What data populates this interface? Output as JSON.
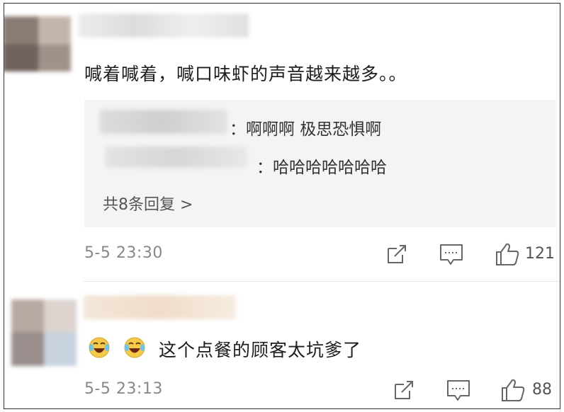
{
  "comments": [
    {
      "text": "喊着喊着，喊口味虾的声音越来越多。。",
      "replies": [
        {
          "separator": "：",
          "text": "啊啊啊 极思恐惧啊"
        },
        {
          "separator": "：",
          "text": "哈哈哈哈哈哈哈"
        }
      ],
      "more_replies": "共8条回复 >",
      "time": "5-5 23:30",
      "like_count": "121"
    },
    {
      "emojis": [
        "laugh-cry-emoji",
        "laugh-cry-emoji"
      ],
      "text": "这个点餐的顾客太坑爹了",
      "time": "5-5 23:13",
      "like_count": "88"
    }
  ],
  "icons": {
    "share": "share-icon",
    "comment": "comment-icon",
    "like": "thumbs-up-icon"
  },
  "colors": {
    "reply_bg": "#f4f4f4",
    "meta_text": "#888888",
    "icon_gray": "#666666"
  }
}
